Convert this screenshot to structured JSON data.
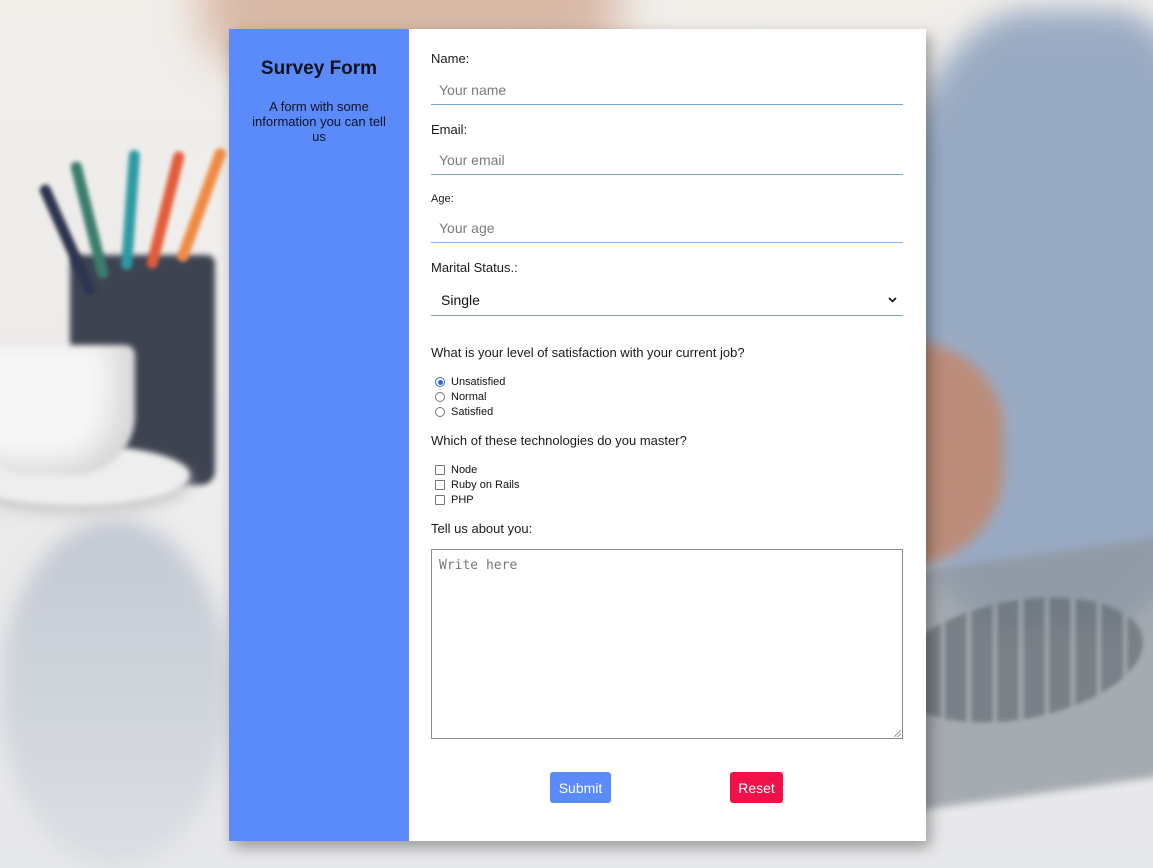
{
  "colors": {
    "sidebar_bg": "#5b8bfa",
    "submit_bg": "#5b8bfa",
    "reset_bg": "#f0104a",
    "radio_checked": "#2f63d9"
  },
  "sidebar": {
    "title": "Survey Form",
    "description": "A form with some information you can tell us"
  },
  "form": {
    "name": {
      "label": "Name:",
      "placeholder": "Your name"
    },
    "email": {
      "label": "Email:",
      "placeholder": "Your email"
    },
    "age": {
      "label": "Age:",
      "placeholder": "Your age"
    },
    "marital": {
      "label": "Marital Status.:",
      "selected": "Single",
      "icon": "chevron-down-icon"
    },
    "satisfaction": {
      "question": "What is your level of satisfaction with your current job?",
      "options": [
        {
          "label": "Unsatisfied",
          "checked": true
        },
        {
          "label": "Normal",
          "checked": false
        },
        {
          "label": "Satisfied",
          "checked": false
        }
      ]
    },
    "technologies": {
      "question": "Which of these technologies do you master?",
      "options": [
        {
          "label": "Node",
          "checked": false
        },
        {
          "label": "Ruby on Rails",
          "checked": false
        },
        {
          "label": "PHP",
          "checked": false
        }
      ]
    },
    "about": {
      "label": "Tell us about you:",
      "placeholder": "Write here"
    },
    "buttons": {
      "submit": "Submit",
      "reset": "Reset"
    }
  }
}
